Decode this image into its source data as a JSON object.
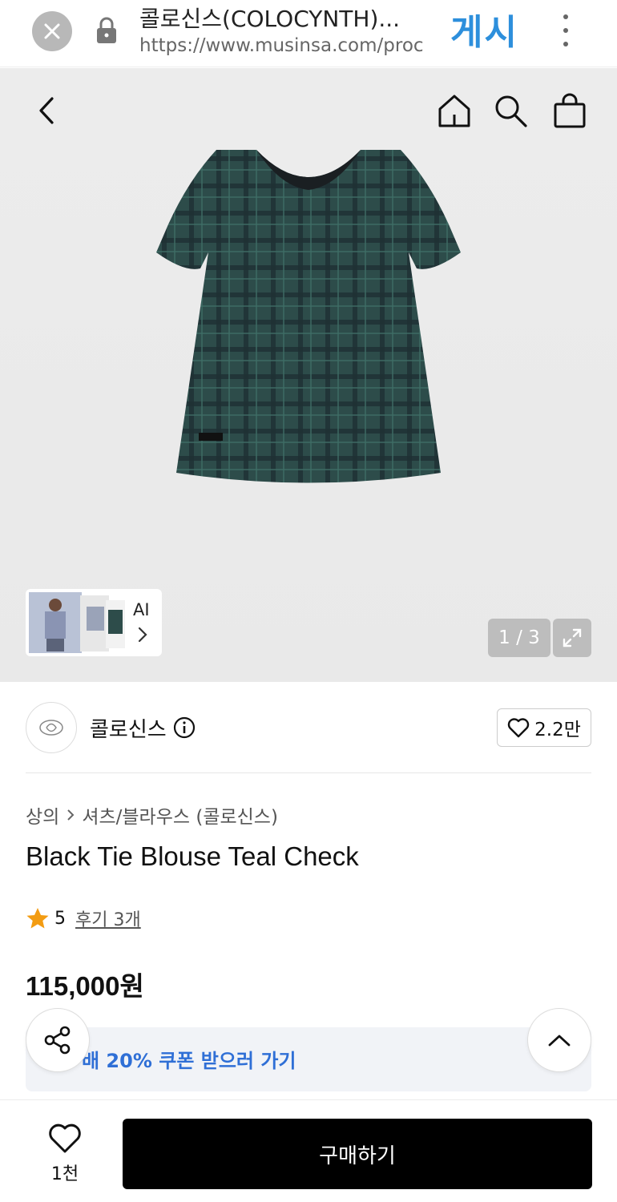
{
  "browser": {
    "title": "콜로신스(COLOCYNTH)...",
    "url": "https://www.musinsa.com/proc",
    "brand_mark": "게시"
  },
  "hero": {
    "page_counter": "1 / 3",
    "thumbnail_label": "AI"
  },
  "brand": {
    "name": "콜로신스",
    "likes": "2.2만"
  },
  "product": {
    "breadcrumb": [
      "상의",
      "셔츠/블라우스 (콜로신스)"
    ],
    "title": "Black Tie Blouse Teal Check",
    "rating": "5",
    "reviews": "후기 3개",
    "price": "115,000원"
  },
  "coupon": {
    "text": "배 20% 쿠폰 받으러 가기"
  },
  "bottom": {
    "wish_count": "1천",
    "buy_label": "구매하기"
  },
  "colors": {
    "accent_blue": "#2f6fd6",
    "brand_blue": "#2d8fdc",
    "star": "#f39c12",
    "blouse_teal": "#2c4a48"
  }
}
